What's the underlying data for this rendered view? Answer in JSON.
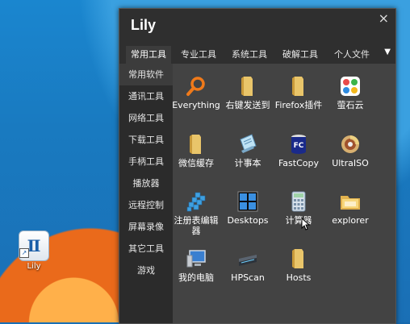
{
  "desktop": {
    "icon_label": "Lily",
    "icon_glyph": "Ⅱ"
  },
  "window": {
    "title": "Lily",
    "close_glyph": "×",
    "more_tabs_glyph": "▼"
  },
  "tabs": [
    {
      "label": "常用工具",
      "active": true
    },
    {
      "label": "专业工具",
      "active": false
    },
    {
      "label": "系统工具",
      "active": false
    },
    {
      "label": "破解工具",
      "active": false
    },
    {
      "label": "个人文件",
      "active": false
    }
  ],
  "sidebar": [
    {
      "label": "常用软件",
      "active": true
    },
    {
      "label": "通讯工具",
      "active": false
    },
    {
      "label": "网络工具",
      "active": false
    },
    {
      "label": "下载工具",
      "active": false
    },
    {
      "label": "手柄工具",
      "active": false
    },
    {
      "label": "播放器",
      "active": false
    },
    {
      "label": "远程控制",
      "active": false
    },
    {
      "label": "屏幕录像",
      "active": false
    },
    {
      "label": "其它工具",
      "active": false
    },
    {
      "label": "游戏",
      "active": false
    }
  ],
  "apps": [
    {
      "label": "Everything",
      "icon": "magnifier-icon"
    },
    {
      "label": "右键发送到",
      "icon": "folder-icon"
    },
    {
      "label": "Firefox插件",
      "icon": "folder-icon"
    },
    {
      "label": "萤石云",
      "icon": "ezviz-icon"
    },
    {
      "label": "微信缓存",
      "icon": "folder-icon"
    },
    {
      "label": "计事本",
      "icon": "notepad-icon"
    },
    {
      "label": "FastCopy",
      "icon": "fastcopy-icon"
    },
    {
      "label": "UltraISO",
      "icon": "disc-icon"
    },
    {
      "label": "注册表编辑器",
      "icon": "registry-icon"
    },
    {
      "label": "Desktops",
      "icon": "desktops-icon"
    },
    {
      "label": "计算器",
      "icon": "calculator-icon"
    },
    {
      "label": "explorer",
      "icon": "explorer-folder-icon"
    },
    {
      "label": "我的电脑",
      "icon": "computer-icon"
    },
    {
      "label": "HPScan",
      "icon": "scanner-icon"
    },
    {
      "label": "Hosts",
      "icon": "folder-icon"
    }
  ],
  "fastcopy_badge": "FC"
}
